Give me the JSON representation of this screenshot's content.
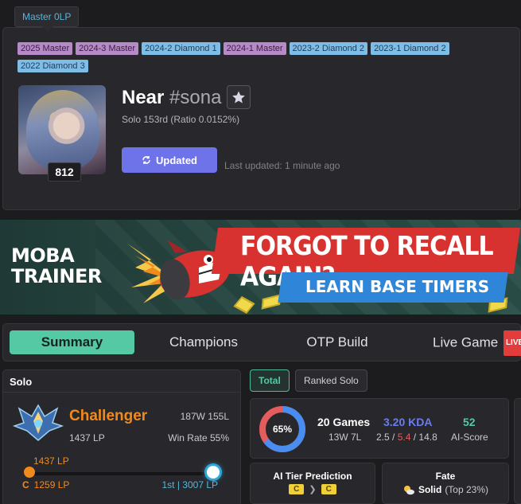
{
  "tooltip": "Master 0LP",
  "badges": [
    {
      "label": "2025  Master",
      "kind": "master"
    },
    {
      "label": "2024-3  Master",
      "kind": "master"
    },
    {
      "label": "2024-2  Diamond 1",
      "kind": "diamond"
    },
    {
      "label": "2024-1  Master",
      "kind": "master"
    },
    {
      "label": "2023-2  Diamond 2",
      "kind": "diamond"
    },
    {
      "label": "2023-1  Diamond 2",
      "kind": "diamond"
    },
    {
      "label": "2022  Diamond 3",
      "kind": "diamond"
    }
  ],
  "profile": {
    "name": "Near",
    "tag": "#sona",
    "level": "812",
    "rank_line": "Solo 153rd (Ratio 0.0152%)",
    "update_label": "Updated",
    "last_updated": "Last updated: 1 minute ago"
  },
  "banner": {
    "logo_line1": "MOBA",
    "logo_line2": "TRAINER",
    "headline": "FORGOT TO RECALL AGAIN?",
    "subline": "LEARN BASE TIMERS"
  },
  "tabs": {
    "summary": "Summary",
    "champions": "Champions",
    "otp_build": "OTP Build",
    "live_game": "Live Game",
    "live_badge": "LIVE"
  },
  "solo": {
    "header": "Solo",
    "tier": "Challenger",
    "lp": "1437 LP",
    "record": "187W 155L",
    "win_rate": "Win Rate 55%",
    "progress_current": "1437 LP",
    "progress_fraction": 0.0,
    "left_letter": "C",
    "left_value": "1259 LP",
    "right_value": "1st | 3007 LP"
  },
  "filters": {
    "total": "Total",
    "ranked_solo": "Ranked Solo"
  },
  "stats": {
    "win_pct": "65%",
    "win_ratio": 0.65,
    "games_title": "20 Games",
    "games_wl": "13W 7L",
    "kda": "3.20 KDA",
    "kills": "2.5",
    "deaths": "5.4",
    "assists": "14.8",
    "ai_score": "52",
    "ai_label": "AI-Score"
  },
  "ai_tier": {
    "title": "AI Tier Prediction",
    "from": "C",
    "to": "C"
  },
  "fate": {
    "title": "Fate",
    "value": "Solid",
    "detail": "(Top 23%)"
  },
  "colors": {
    "accent_green": "#55c8a4",
    "accent_purple": "#6f73ea",
    "challenger_orange": "#f08a1c",
    "loss_red": "#e45c5c"
  }
}
